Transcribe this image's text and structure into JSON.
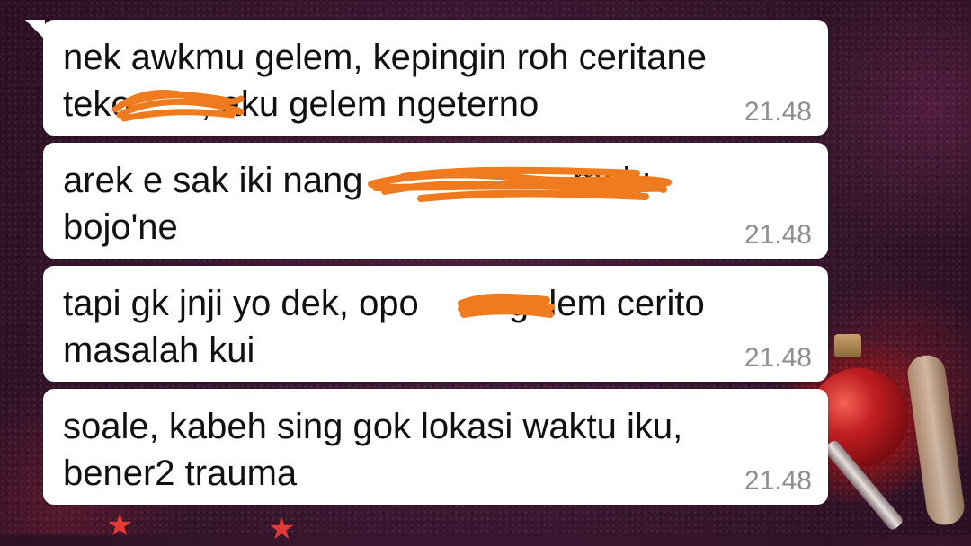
{
  "messages": [
    {
      "line1": "nek awkmu gelem, kepingin roh ceritane",
      "line2": "teko       , aku gelem ngeterno",
      "time": "21.48"
    },
    {
      "line1": "arek e sak iki nang                     melu",
      "line2": "bojo'ne",
      "time": "21.48"
    },
    {
      "line1": "tapi gk jnji yo dek, opo         gelem cerito",
      "line2": "masalah kui",
      "time": "21.48"
    },
    {
      "line1": "soale, kabeh sing gok lokasi waktu iku,",
      "line2": "bener2 trauma",
      "time": "21.48"
    }
  ],
  "colors": {
    "bubble": "#ffffff",
    "text": "#111111",
    "timestamp": "#8e8e8e",
    "redaction": "#f07a1e",
    "background": "#3a1730"
  },
  "icons": {
    "bubble_tail": "incoming-tail"
  }
}
